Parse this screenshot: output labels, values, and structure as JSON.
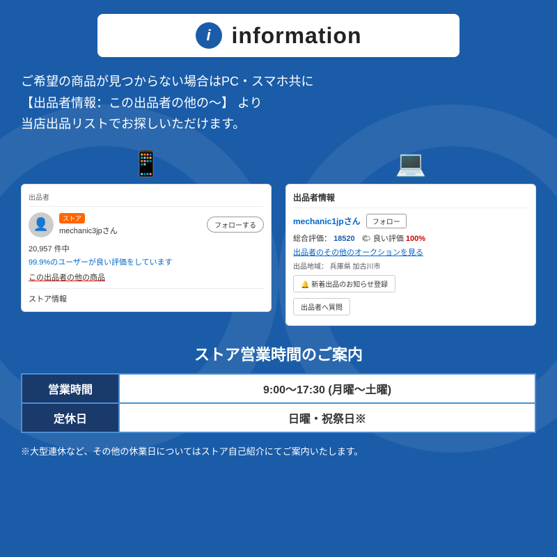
{
  "header": {
    "icon_text": "i",
    "title": "information"
  },
  "main_description": {
    "line1": "ご希望の商品が見つからない場合はPC・スマホ共に",
    "line2": "【出品者情報：この出品者の他の〜】 より",
    "line3": "当店出品リストでお探しいただけます。"
  },
  "mobile_screenshot": {
    "section_label": "出品者",
    "store_badge": "ストア",
    "seller_name": "mechanic3jpさん",
    "follow_button": "フォローする",
    "stats": "20,957 件中",
    "rating_text": "99.9%のユーザーが良い評価をしています",
    "other_items_link": "この出品者の他の商品",
    "store_info": "ストア情報"
  },
  "pc_screenshot": {
    "section_label": "出品者情報",
    "seller_name": "mechanic1jpさん",
    "follow_button": "フォロー",
    "total_rating_label": "総合評価：",
    "total_rating_value": "18520",
    "good_rating_label": "🌤 良い評価",
    "good_rating_value": "100%",
    "auction_link": "出品者のその他のオークションを見る",
    "location_label": "出品地域：",
    "location_value": "兵庫県 加古川市",
    "notify_button": "🔔 新着出品のお知らせ登録",
    "question_button": "出品者へ質問"
  },
  "hours_section": {
    "title": "ストア営業時間のご案内",
    "rows": [
      {
        "label": "営業時間",
        "value": "9:00〜17:30 (月曜〜土曜)"
      },
      {
        "label": "定休日",
        "value": "日曜・祝祭日※"
      }
    ],
    "note": "※大型連休など、その他の休業日についてはストア自己紹介にてご案内いたします。"
  }
}
